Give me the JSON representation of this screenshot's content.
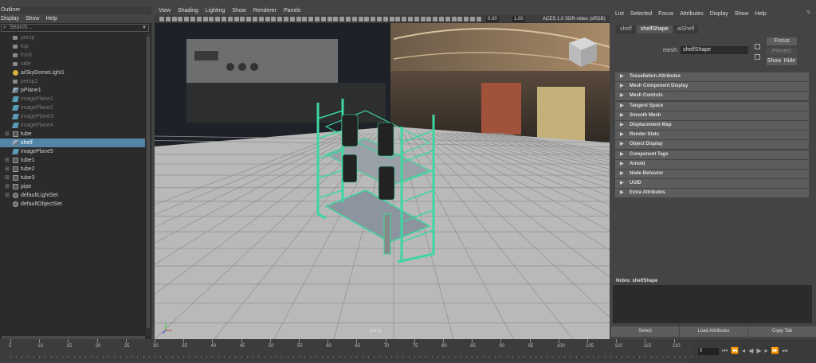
{
  "outliner": {
    "title": "Outliner",
    "menu": [
      "Display",
      "Show",
      "Help"
    ],
    "search_placeholder": "Search...",
    "items": [
      {
        "label": "persp",
        "icon": "camera-icon",
        "dim": true,
        "expand": false,
        "selected": false
      },
      {
        "label": "top",
        "icon": "camera-icon",
        "dim": true,
        "expand": false,
        "selected": false
      },
      {
        "label": "front",
        "icon": "camera-icon",
        "dim": true,
        "expand": false,
        "selected": false
      },
      {
        "label": "side",
        "icon": "camera-icon",
        "dim": true,
        "expand": false,
        "selected": false
      },
      {
        "label": "aiSkyDomeLight1",
        "icon": "light-icon",
        "dim": false,
        "expand": false,
        "selected": false
      },
      {
        "label": "persp1",
        "icon": "camera-icon",
        "dim": true,
        "expand": false,
        "selected": false
      },
      {
        "label": "pPlane1",
        "icon": "mesh-icon",
        "dim": false,
        "expand": false,
        "selected": false
      },
      {
        "label": "imagePlane1",
        "icon": "image-plane-icon",
        "dim": true,
        "expand": false,
        "selected": false
      },
      {
        "label": "imagePlane2",
        "icon": "image-plane-icon",
        "dim": true,
        "expand": false,
        "selected": false
      },
      {
        "label": "imagePlane3",
        "icon": "image-plane-icon",
        "dim": true,
        "expand": false,
        "selected": false
      },
      {
        "label": "imagePlane4",
        "icon": "image-plane-icon",
        "dim": true,
        "expand": false,
        "selected": false
      },
      {
        "label": "tube",
        "icon": "group-icon",
        "dim": false,
        "expand": true,
        "selected": false
      },
      {
        "label": "shelf",
        "icon": "mesh-icon",
        "dim": false,
        "expand": false,
        "selected": true
      },
      {
        "label": "imagePlane5",
        "icon": "image-plane-icon",
        "dim": false,
        "expand": false,
        "selected": false
      },
      {
        "label": "tube1",
        "icon": "group-icon",
        "dim": false,
        "expand": true,
        "selected": false
      },
      {
        "label": "tube2",
        "icon": "group-icon",
        "dim": false,
        "expand": true,
        "selected": false
      },
      {
        "label": "tube3",
        "icon": "group-icon",
        "dim": false,
        "expand": true,
        "selected": false
      },
      {
        "label": "pipe",
        "icon": "group-icon",
        "dim": false,
        "expand": true,
        "selected": false
      },
      {
        "label": "defaultLightSet",
        "icon": "set-icon",
        "dim": false,
        "expand": true,
        "selected": false
      },
      {
        "label": "defaultObjectSet",
        "icon": "set-icon",
        "dim": false,
        "expand": false,
        "selected": false
      }
    ]
  },
  "viewport": {
    "menu": [
      "View",
      "Shading",
      "Lighting",
      "Show",
      "Renderer",
      "Panels"
    ],
    "exposure": "0.00",
    "gamma": "1.00",
    "colorspace": "ACES 1.0 SDR-video (sRGB)",
    "camera_label": "persp",
    "colors": {
      "wireframe": "#3dd6a0",
      "grid_floor": "#b9b9b9",
      "shelf_board": "#8c94a0"
    }
  },
  "attribute_editor": {
    "menu": [
      "List",
      "Selected",
      "Focus",
      "Attributes",
      "Display",
      "Show",
      "Help"
    ],
    "tabs": [
      "shelf",
      "shelfShape",
      "aiShelf"
    ],
    "active_tab": "shelfShape",
    "mesh_label": "mesh:",
    "mesh_value": "shelfShape",
    "focus_label": "Focus",
    "presets_label": "Presets",
    "show_label": "Show",
    "hide_label": "Hide",
    "sections": [
      "Tessellation Attributes",
      "Mesh Component Display",
      "Mesh Controls",
      "Tangent Space",
      "Smooth Mesh",
      "Displacement Map",
      "Render Stats",
      "Object Display",
      "Component Tags",
      "Arnold",
      "Node Behavior",
      "UUID",
      "Extra Attributes"
    ],
    "notes_label": "Notes:  shelfShape",
    "bottom_buttons": [
      "Select",
      "Load Attributes",
      "Copy Tab"
    ]
  },
  "timeline": {
    "labels": [
      "5",
      "10",
      "15",
      "20",
      "25",
      "30",
      "35",
      "40",
      "45",
      "50",
      "55",
      "60",
      "65",
      "70",
      "75",
      "80",
      "85",
      "90",
      "95",
      "100",
      "105",
      "110",
      "115",
      "120"
    ],
    "current_frame": "0",
    "controls": [
      "go-to-start-icon",
      "step-back-key-icon",
      "step-back-frame-icon",
      "play-backward-icon",
      "play-forward-icon",
      "step-forward-frame-icon",
      "step-forward-key-icon",
      "go-to-end-icon"
    ]
  }
}
